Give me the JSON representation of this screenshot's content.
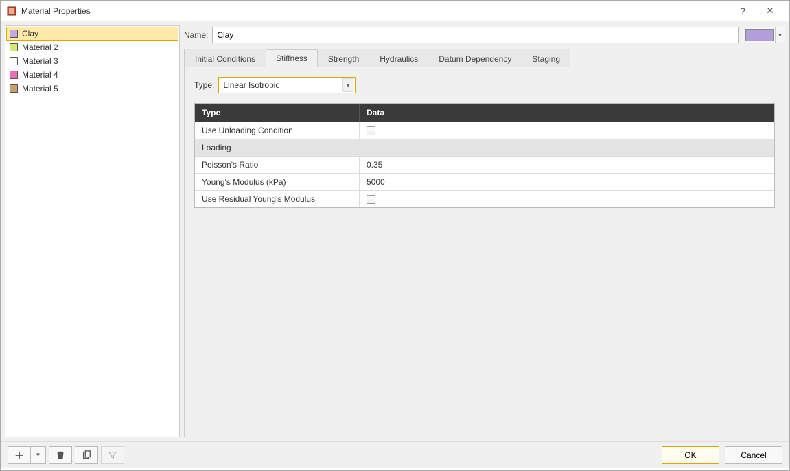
{
  "window": {
    "title": "Material Properties"
  },
  "materials": [
    {
      "name": "Clay",
      "color": "#c3aae0",
      "selected": true
    },
    {
      "name": "Material 2",
      "color": "#d7e87a",
      "selected": false
    },
    {
      "name": "Material 3",
      "color": "#ffffff",
      "selected": false
    },
    {
      "name": "Material 4",
      "color": "#e86fb5",
      "selected": false
    },
    {
      "name": "Material 5",
      "color": "#c9a06b",
      "selected": false
    }
  ],
  "name_field": {
    "label": "Name:",
    "value": "Clay"
  },
  "material_color": "#b39ddb",
  "tabs": [
    {
      "label": "Initial Conditions",
      "active": false
    },
    {
      "label": "Stiffness",
      "active": true
    },
    {
      "label": "Strength",
      "active": false
    },
    {
      "label": "Hydraulics",
      "active": false
    },
    {
      "label": "Datum Dependency",
      "active": false
    },
    {
      "label": "Staging",
      "active": false
    }
  ],
  "type_field": {
    "label": "Type:",
    "value": "Linear Isotropic"
  },
  "table": {
    "headers": {
      "type": "Type",
      "data": "Data"
    },
    "rows": [
      {
        "kind": "checkbox",
        "label": "Use Unloading Condition",
        "checked": false
      },
      {
        "kind": "section",
        "label": "Loading"
      },
      {
        "kind": "value",
        "label": "Poisson's Ratio",
        "value": "0.35"
      },
      {
        "kind": "value",
        "label": "Young's Modulus (kPa)",
        "value": "5000"
      },
      {
        "kind": "checkbox",
        "label": "Use Residual Young's Modulus",
        "checked": false
      }
    ]
  },
  "toolbar": {
    "add": "add-icon",
    "add_menu": "chevron-down-icon",
    "delete": "trash-icon",
    "copy": "copy-icon",
    "filter": "filter-icon"
  },
  "buttons": {
    "ok": "OK",
    "cancel": "Cancel"
  }
}
